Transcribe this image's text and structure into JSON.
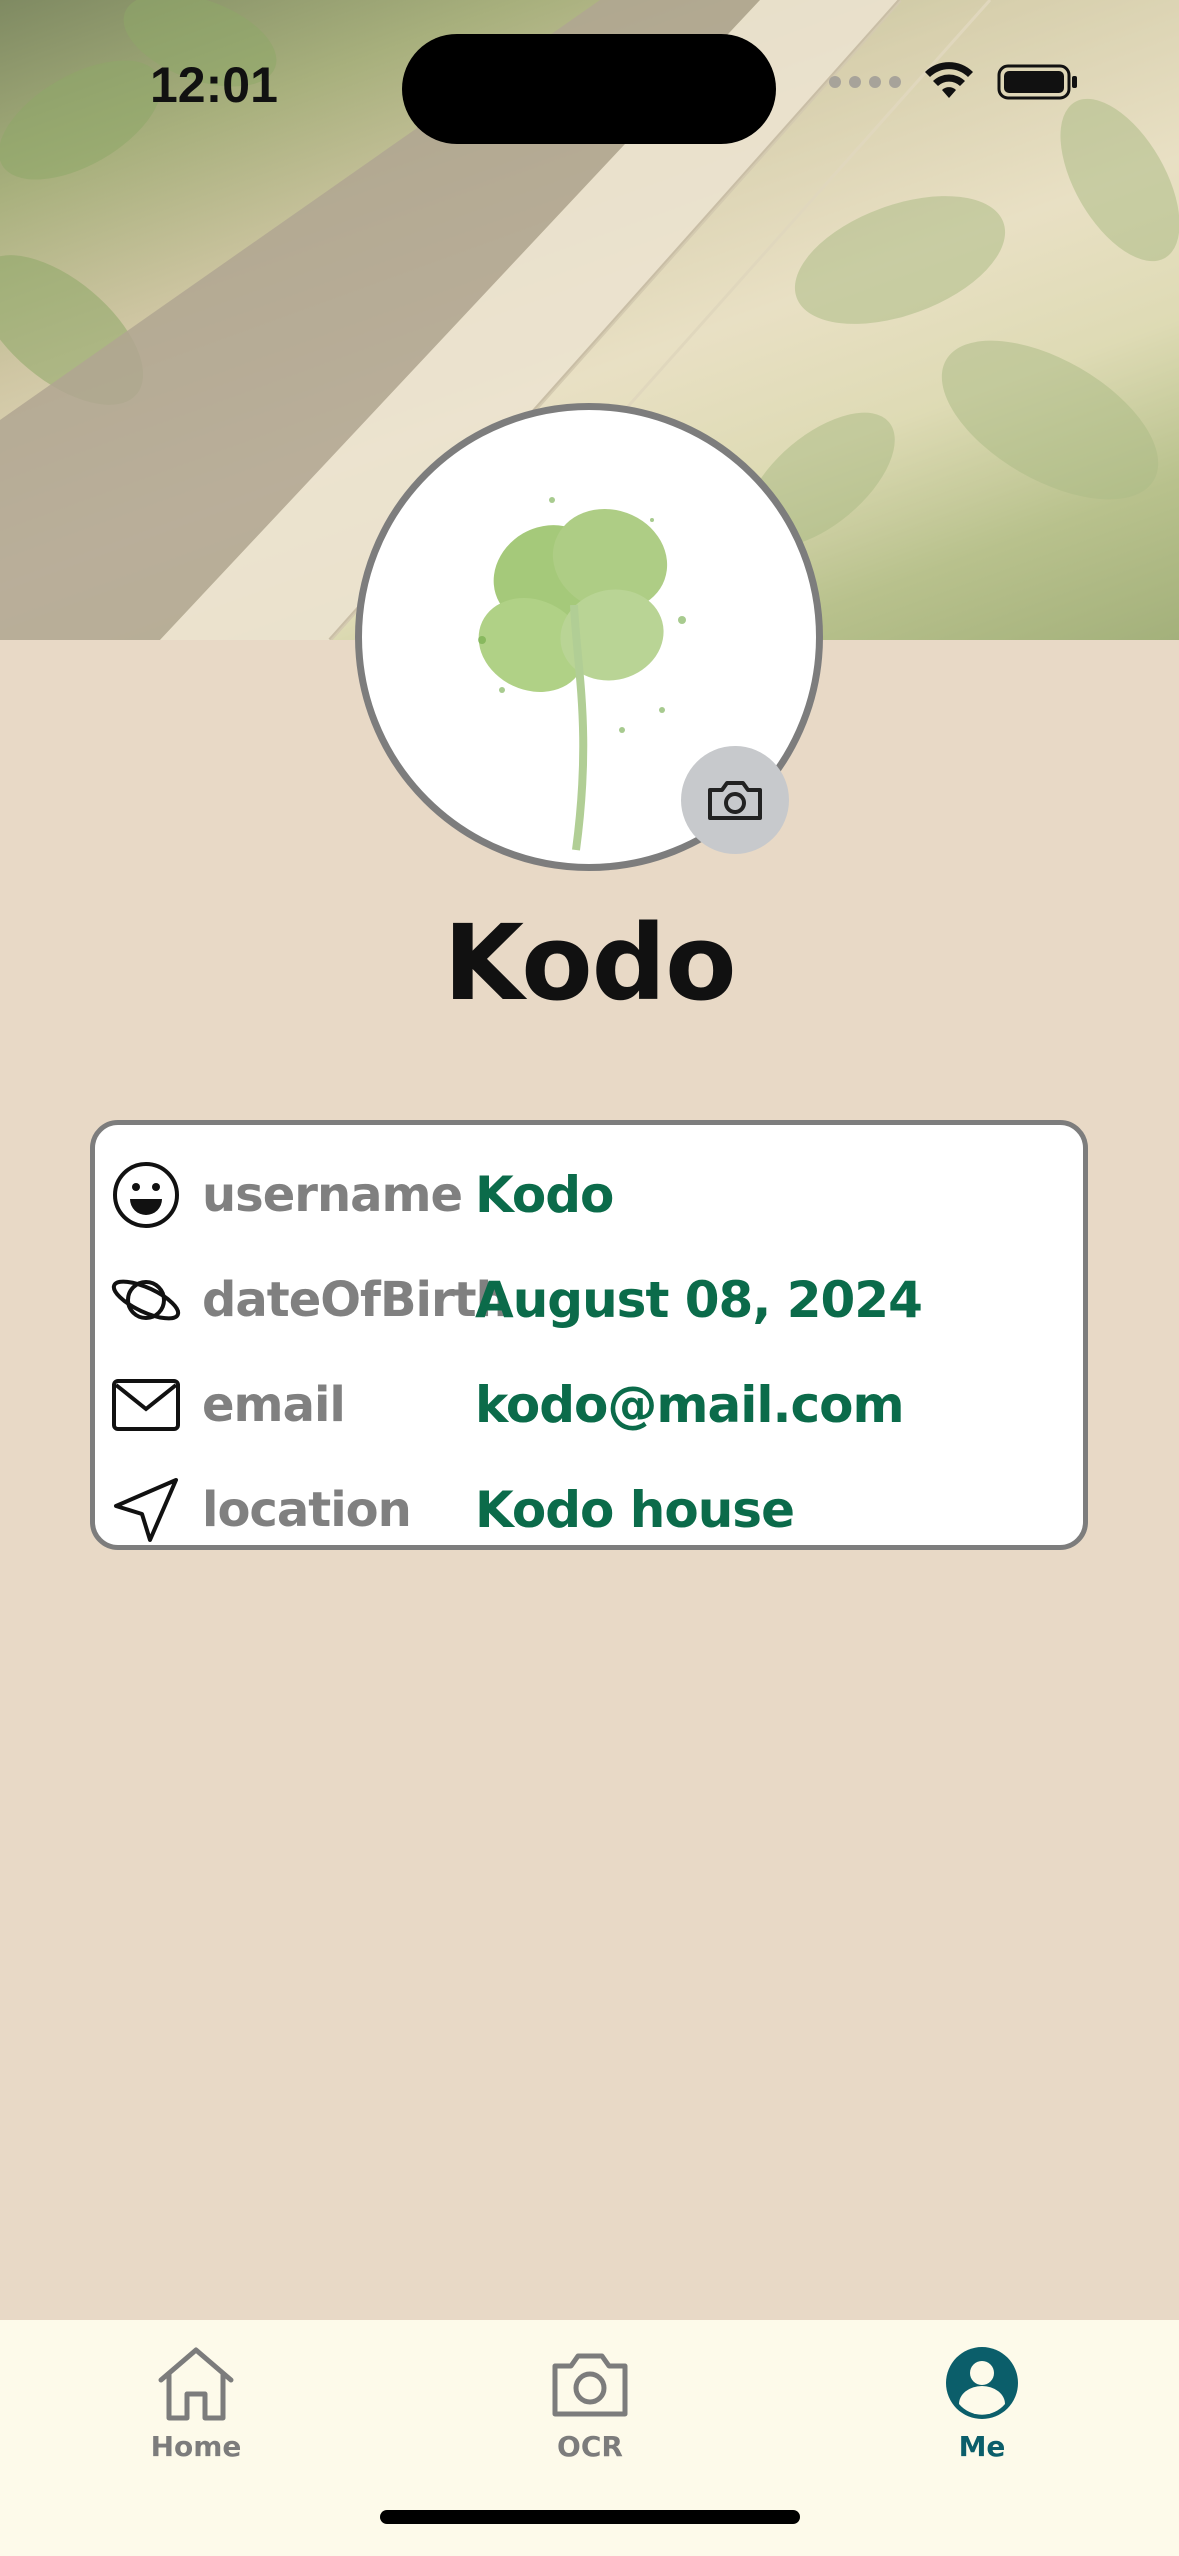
{
  "status_bar": {
    "time": "12:01"
  },
  "profile": {
    "name": "Kodo",
    "cover_theme": "book-with-leaves",
    "avatar_theme": "four-leaf-clover-watercolor"
  },
  "info": [
    {
      "icon": "smiley-icon",
      "label": "username",
      "value": "Kodo"
    },
    {
      "icon": "planet-icon",
      "label": "dateOfBirth",
      "value": "August 08, 2024"
    },
    {
      "icon": "mail-icon",
      "label": "email",
      "value": "kodo@mail.com"
    },
    {
      "icon": "location-arrow-icon",
      "label": "location",
      "value": "Kodo house"
    }
  ],
  "tabs": [
    {
      "label": "Home",
      "icon": "home-icon",
      "active": false
    },
    {
      "label": "OCR",
      "icon": "camera-icon",
      "active": false
    },
    {
      "label": "Me",
      "icon": "user-circle-icon",
      "active": true
    }
  ],
  "colors": {
    "background": "#e8d9c6",
    "value_text": "#0b6b4a",
    "label_text": "#808080",
    "tab_active": "#0b5e6a",
    "tab_bar": "#fdfaea"
  }
}
